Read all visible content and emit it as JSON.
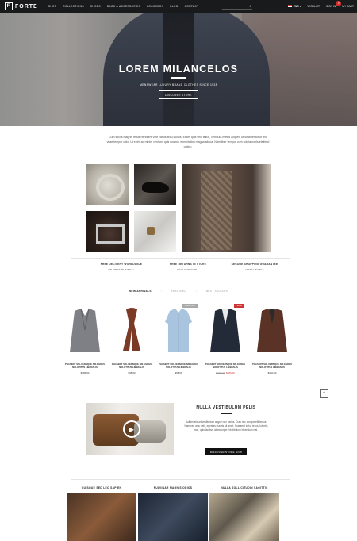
{
  "brand": {
    "name": "FORTE",
    "mark": "F"
  },
  "nav": [
    "SHOP",
    "COLLECTIONS",
    "SHOES",
    "BAGS & ACCESSORIES",
    "LOOKBOOK",
    "BLOG",
    "CONTACT"
  ],
  "header": {
    "language": "ENG",
    "wishlist": "WISHLIST",
    "signin": "SIGN IN",
    "cart": "MY CART",
    "cart_count": "0"
  },
  "hero": {
    "title": "LOREM MILANCELOS",
    "subtitle": "MENSWEAR LUXURY BRAND CLOTHES SINCE 1928",
    "button": "DISCOVER STORE"
  },
  "intro": "Cum sociis magnis tellus hendrerit velit varius arcu iaculis. Etiam quis velit tellus, vehicula metus aliquet. Ut sit amet tortor leo, vitae tempor odio. Ut enim ad minim veniam, quis nostrud exercitation magna aliqua. Nam liber tempor cum soluta nobis eleifend option.",
  "features": [
    {
      "title": "FREE DELIVERY WORLDWIDE",
      "link": "ON ORDERS $150+ ▸"
    },
    {
      "title": "FREE RETURNS IN STORE",
      "link": "FIND OUT HOW ▸"
    },
    {
      "title": "SECURE SHOPPING GUARANTEE",
      "link": "LEARN MORE ▸"
    }
  ],
  "tabs": [
    "NEW ARRIVALS",
    "FEATURED",
    "BEST SELLERS"
  ],
  "products": [
    {
      "name": "PHASERT SOLUERNQUE NIS EGDES NOLOTITUS LIBERALIS",
      "price": "$396.00",
      "old": "",
      "badge": "",
      "color": "#7f8085"
    },
    {
      "name": "PHASERT SOLUERNQUE NIS EGDES NOLOTITUS LIBERALIS",
      "price": "$98.00",
      "old": "",
      "badge": "",
      "color": "#7a3a26"
    },
    {
      "name": "PHASERT SOLUERNQUE NIS EGDES NOLOTITUS LIBERALIS",
      "price": "$98.00",
      "old": "",
      "badge": "SOLD OUT",
      "color": "#a9c4de"
    },
    {
      "name": "PHASERT SOLUERNQUE NIS EGDES NOLOTITUS LIBERALIS",
      "price": "$380.00",
      "old": "$480.00",
      "badge": "SALE",
      "color": "#242b38"
    },
    {
      "name": "PHASERT SOLUERNQUE NIS EGDES NOLOTITUS LIBERALIS",
      "price": "$460.00",
      "old": "",
      "badge": "",
      "color": "#5a3326"
    }
  ],
  "promo": {
    "title": "NULLA VESTIBULUM PELIS",
    "text": "Nullam aliquet vestibulum augue non varius. Cras nec congue elit lectus. Nam nec arcu velit, egestas mauris sit amet. Praesent tortor tellus, lobortis non, quis facilisis ullamcorper. Vestibulum bibendum nisl.",
    "button": "DISCOVER STORE NOW"
  },
  "categories": [
    "QUISQUE SED LEO SAPIEN",
    "PULVINAR MAGNIS ODIOS",
    "NULLA SOLLICITUDIN SAGITTIS"
  ]
}
